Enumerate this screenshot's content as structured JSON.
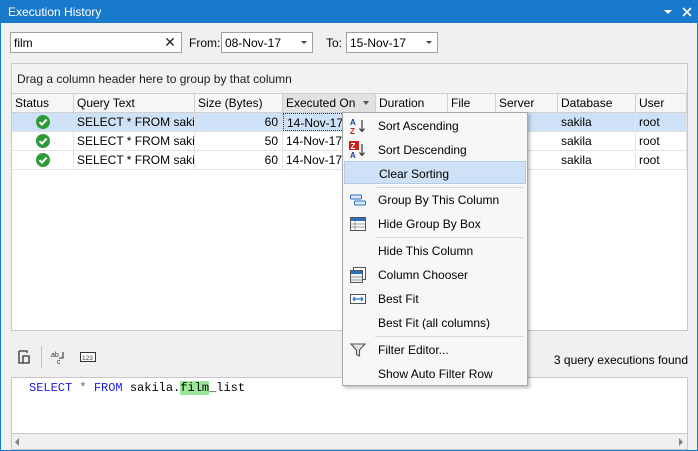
{
  "window": {
    "title": "Execution History"
  },
  "filters": {
    "search_value": "film",
    "from_label": "From:",
    "from_value": "08-Nov-17",
    "to_label": "To:",
    "to_value": "15-Nov-17"
  },
  "grid": {
    "group_panel_text": "Drag a column header here to group by that column",
    "columns": [
      "Status",
      "Query Text",
      "Size (Bytes)",
      "Executed On",
      "Duration",
      "File",
      "Server",
      "Database",
      "User"
    ],
    "rows": [
      {
        "query": "SELECT * FROM sakil...",
        "size": "60",
        "executed": "14-Nov-17",
        "database": "sakila",
        "user": "root",
        "selected": true
      },
      {
        "query": "SELECT * FROM sakil...",
        "size": "50",
        "executed": "14-Nov-17",
        "database": "sakila",
        "user": "root",
        "selected": false
      },
      {
        "query": "SELECT * FROM sakil...",
        "size": "60",
        "executed": "14-Nov-17",
        "database": "sakila",
        "user": "root",
        "selected": false
      }
    ]
  },
  "context_menu": {
    "items": [
      {
        "label": "Sort Ascending",
        "icon": "sort-ascending-icon"
      },
      {
        "label": "Sort Descending",
        "icon": "sort-descending-icon"
      },
      {
        "label": "Clear Sorting",
        "icon": "",
        "hover": true
      },
      {
        "label": "Group By This Column",
        "icon": "group-by-column-icon"
      },
      {
        "label": "Hide Group By Box",
        "icon": "group-by-box-icon"
      },
      {
        "label": "Hide This Column",
        "icon": ""
      },
      {
        "label": "Column Chooser",
        "icon": "column-chooser-icon"
      },
      {
        "label": "Best Fit",
        "icon": "best-fit-icon"
      },
      {
        "label": "Best Fit (all columns)",
        "icon": ""
      },
      {
        "label": "Filter Editor...",
        "icon": "filter-icon"
      },
      {
        "label": "Show Auto Filter Row",
        "icon": ""
      }
    ]
  },
  "bottom_toolbar": {
    "found_text": "3 query executions found",
    "icons": [
      "copy-to-editor-icon",
      "wrap-text-icon",
      "numbers-icon"
    ]
  },
  "sql": {
    "keyword_select": "SELECT",
    "star": "*",
    "keyword_from": "FROM",
    "schema": "sakila.",
    "match": "film",
    "rest": "_list"
  },
  "colors": {
    "titlebar": "#1979ca",
    "selection": "#cfe1f6",
    "status_ok": "#2e9b3b",
    "sql_keyword": "#1a1ae6",
    "sql_match": "#99e699"
  }
}
